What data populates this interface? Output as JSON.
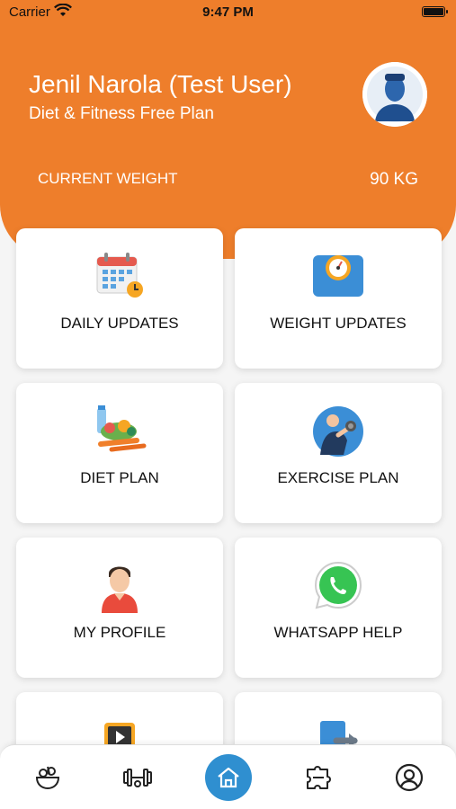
{
  "status_bar": {
    "carrier": "Carrier",
    "time": "9:47 PM"
  },
  "header": {
    "user_name": "Jenil Narola (Test User)",
    "plan": "Diet & Fitness Free Plan",
    "weight_label": "CURRENT WEIGHT",
    "weight_value": "90 KG"
  },
  "cards": [
    {
      "label": "DAILY UPDATES",
      "icon": "calendar-icon"
    },
    {
      "label": "WEIGHT UPDATES",
      "icon": "scale-icon"
    },
    {
      "label": "DIET PLAN",
      "icon": "food-icon"
    },
    {
      "label": "EXERCISE PLAN",
      "icon": "dumbbell-person-icon"
    },
    {
      "label": "MY PROFILE",
      "icon": "person-icon"
    },
    {
      "label": "WHATSAPP HELP",
      "icon": "whatsapp-icon"
    },
    {
      "label": "",
      "icon": "video-icon"
    },
    {
      "label": "",
      "icon": "logout-icon"
    }
  ],
  "tab_bar": {
    "tabs": [
      "food-bowl-icon",
      "dumbbell-icon",
      "home-icon",
      "puzzle-icon",
      "account-icon"
    ],
    "active_tab": "home-icon"
  },
  "colors": {
    "primary": "#ee7e2b",
    "accent": "#2f8fd0"
  }
}
